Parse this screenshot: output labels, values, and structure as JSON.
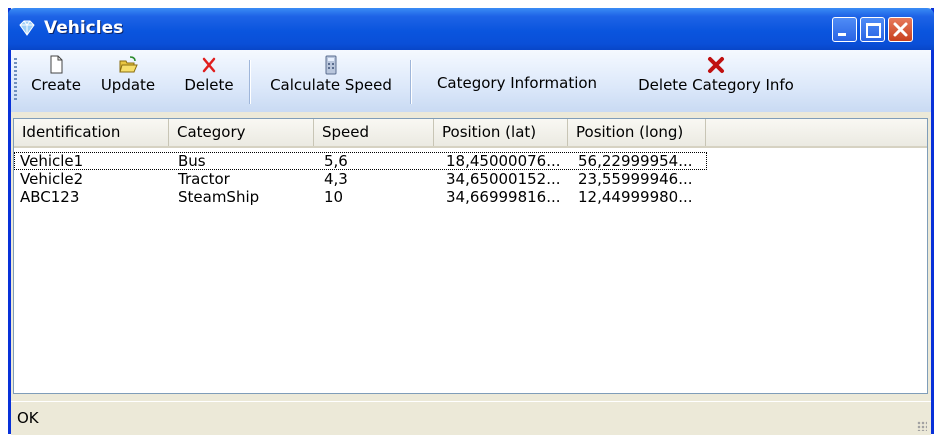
{
  "window": {
    "title": "Vehicles",
    "title_icon": "gem-icon",
    "titlebar_color": "#0A55DE",
    "close_color": "#C8401E"
  },
  "toolbar": {
    "create": {
      "label": "Create",
      "icon": "new-document-icon"
    },
    "update": {
      "label": "Update",
      "icon": "open-folder-icon"
    },
    "delete": {
      "label": "Delete",
      "icon": "red-x-icon"
    },
    "calculate_speed": {
      "label": "Calculate Speed",
      "icon": "calculator-icon"
    },
    "category_information": {
      "label": "Category Information"
    },
    "delete_category_info": {
      "label": "Delete Category Info",
      "icon": "bold-red-x-icon"
    }
  },
  "list": {
    "columns": [
      "Identification",
      "Category",
      "Speed",
      "Position (lat)",
      "Position (long)"
    ],
    "rows": [
      [
        "Vehicle1",
        "Bus",
        "5,6",
        "18,45000076...",
        "56,22999954..."
      ],
      [
        "Vehicle2",
        "Tractor",
        "4,3",
        "34,65000152...",
        "23,55999946..."
      ],
      [
        "ABC123",
        "SteamShip",
        "10",
        "34,66999816...",
        "12,44999980..."
      ]
    ],
    "focused_row": 0
  },
  "status": {
    "text": "OK"
  }
}
